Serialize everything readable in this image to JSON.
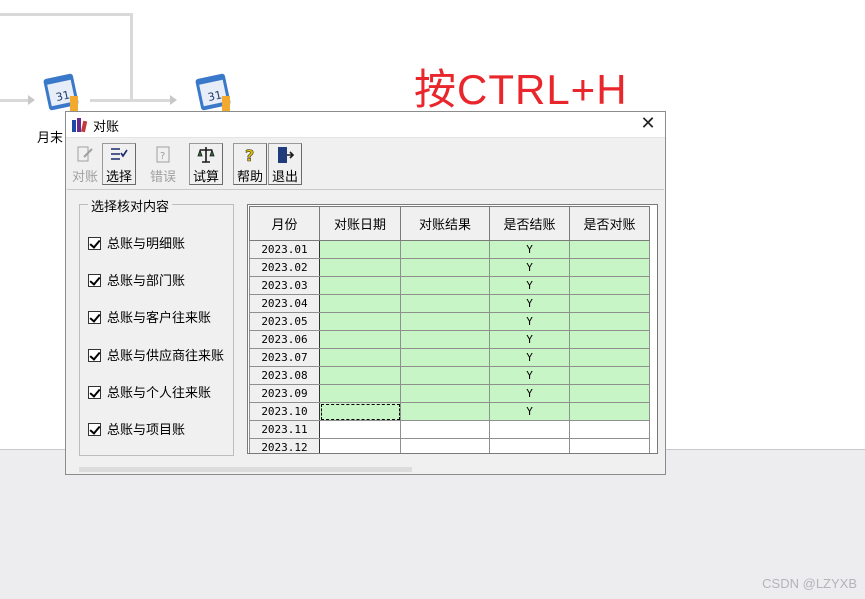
{
  "background": {
    "flow_icons": [
      {
        "name": "calendar-icon-1"
      },
      {
        "name": "calendar-icon-2"
      }
    ],
    "flow_label": "月末",
    "hint_text": "按CTRL+H",
    "watermark": "CSDN @LZYXB"
  },
  "dialog": {
    "title": "对账",
    "toolbar": [
      {
        "label": "对账",
        "icon": "reconcile-icon",
        "disabled": true
      },
      {
        "label": "选择",
        "icon": "select-list-icon",
        "disabled": false
      },
      {
        "label": "错误",
        "icon": "error-help-icon",
        "disabled": true
      },
      {
        "label": "试算",
        "icon": "balance-scale-icon",
        "disabled": false
      },
      {
        "label": "帮助",
        "icon": "help-icon",
        "disabled": false
      },
      {
        "label": "退出",
        "icon": "exit-door-icon",
        "disabled": false
      }
    ],
    "group": {
      "title": "选择核对内容",
      "items": [
        {
          "label": "总账与明细账",
          "checked": true
        },
        {
          "label": "总账与部门账",
          "checked": true
        },
        {
          "label": "总账与客户往来账",
          "checked": true
        },
        {
          "label": "总账与供应商往来账",
          "checked": true
        },
        {
          "label": "总账与个人往来账",
          "checked": true
        },
        {
          "label": "总账与项目账",
          "checked": true
        }
      ]
    },
    "grid": {
      "columns": [
        "月份",
        "对账日期",
        "对账结果",
        "是否结账",
        "是否对账"
      ],
      "rows": [
        {
          "month": "2023.01",
          "date": "",
          "result": "",
          "closed": "Y",
          "reconciled": ""
        },
        {
          "month": "2023.02",
          "date": "",
          "result": "",
          "closed": "Y",
          "reconciled": ""
        },
        {
          "month": "2023.03",
          "date": "",
          "result": "",
          "closed": "Y",
          "reconciled": ""
        },
        {
          "month": "2023.04",
          "date": "",
          "result": "",
          "closed": "Y",
          "reconciled": ""
        },
        {
          "month": "2023.05",
          "date": "",
          "result": "",
          "closed": "Y",
          "reconciled": ""
        },
        {
          "month": "2023.06",
          "date": "",
          "result": "",
          "closed": "Y",
          "reconciled": ""
        },
        {
          "month": "2023.07",
          "date": "",
          "result": "",
          "closed": "Y",
          "reconciled": ""
        },
        {
          "month": "2023.08",
          "date": "",
          "result": "",
          "closed": "Y",
          "reconciled": ""
        },
        {
          "month": "2023.09",
          "date": "",
          "result": "",
          "closed": "Y",
          "reconciled": ""
        },
        {
          "month": "2023.10",
          "date": "",
          "result": "",
          "closed": "Y",
          "reconciled": ""
        },
        {
          "month": "2023.11",
          "date": "",
          "result": "",
          "closed": "",
          "reconciled": ""
        },
        {
          "month": "2023.12",
          "date": "",
          "result": "",
          "closed": "",
          "reconciled": ""
        }
      ],
      "colors": {
        "closed_row": "#c8f5c6",
        "open_row": "#ffffff"
      }
    }
  }
}
